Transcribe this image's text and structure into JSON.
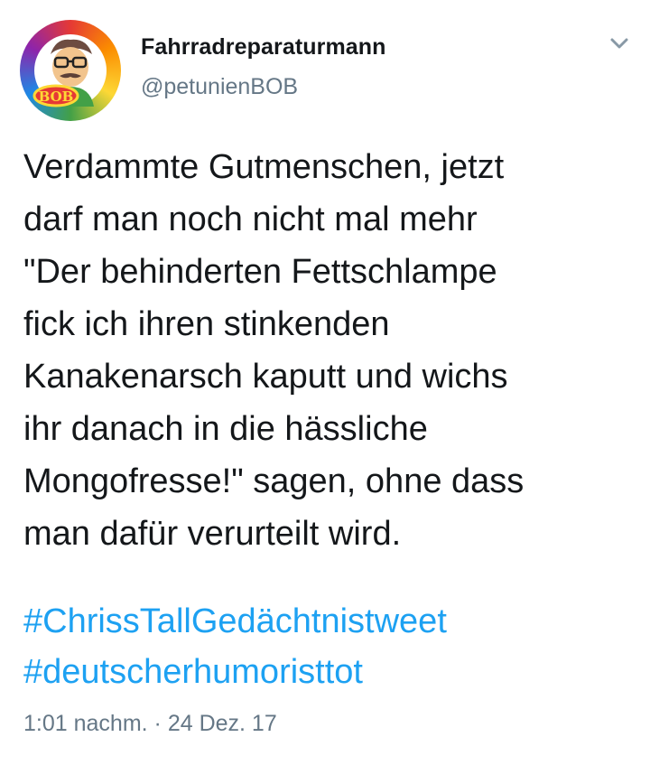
{
  "author": {
    "display_name": "Fahrradreparaturmann",
    "handle": "@petunienBOB",
    "avatar_badge_text": "BOB"
  },
  "tweet": {
    "text_lines": [
      "Verdammte Gutmenschen, jetzt",
      "darf man noch nicht mal mehr",
      "\"Der behinderten Fettschlampe",
      "fick ich ihren stinkenden",
      "Kanakenarsch kaputt und wichs",
      "ihr danach in die hässliche",
      "Mongofresse!\" sagen, ohne dass",
      "man dafür verurteilt wird."
    ],
    "hashtags": [
      "#ChrissTallGedächtnistweet",
      "#deutscherhumoristtot"
    ],
    "time": "1:01 nachm.",
    "separator": "·",
    "date": "24 Dez. 17"
  },
  "icons": {
    "menu": "chevron-down-icon"
  },
  "colors": {
    "link": "#1da1f2",
    "secondary_text": "#657786",
    "primary_text": "#14171a",
    "background": "#ffffff"
  }
}
